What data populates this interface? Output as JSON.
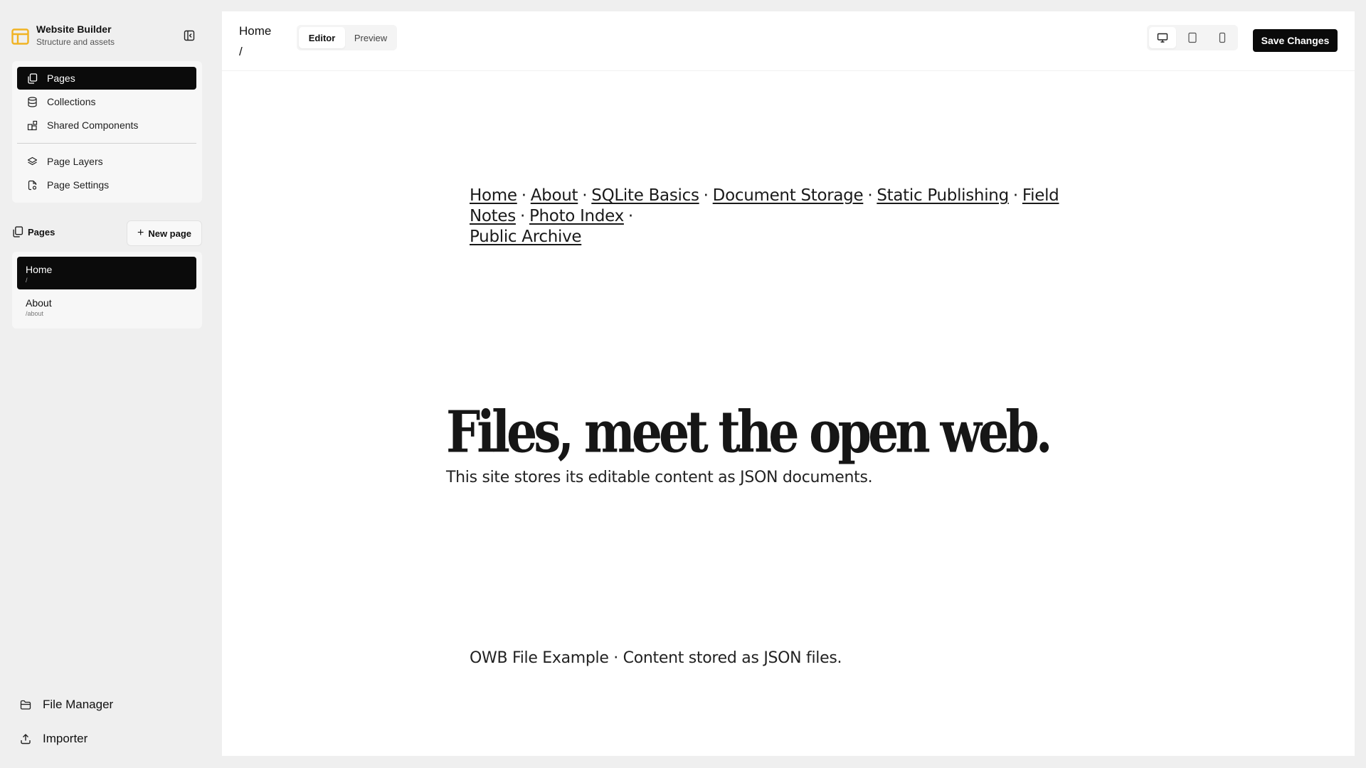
{
  "app": {
    "title": "Website Builder",
    "subtitle": "Structure and assets",
    "accent_color": "#f0b323",
    "logo_icon": "layout-icon",
    "collapse_icon": "sidebar-collapse-icon"
  },
  "sidebar": {
    "nav_items": [
      {
        "label": "Pages",
        "icon": "pages-icon",
        "active": true
      },
      {
        "label": "Collections",
        "icon": "database-icon",
        "active": false
      },
      {
        "label": "Shared Components",
        "icon": "components-icon",
        "active": false
      },
      {
        "label": "Page Layers",
        "icon": "layers-icon",
        "active": false
      },
      {
        "label": "Page Settings",
        "icon": "page-settings-icon",
        "active": false
      }
    ],
    "pages_section": {
      "label": "Pages",
      "new_page_label": "New page"
    },
    "pages": [
      {
        "name": "Home",
        "path": "/",
        "active": true
      },
      {
        "name": "About",
        "path": "/about",
        "active": false
      }
    ],
    "bottom_items": [
      {
        "label": "File Manager",
        "icon": "folder-icon"
      },
      {
        "label": "Importer",
        "icon": "upload-icon"
      }
    ]
  },
  "topbar": {
    "page_title": "Home",
    "page_path": "/",
    "tabs": [
      {
        "label": "Editor",
        "active": true
      },
      {
        "label": "Preview",
        "active": false
      }
    ],
    "devices": [
      {
        "name": "desktop",
        "icon": "desktop-icon",
        "active": true
      },
      {
        "name": "tablet",
        "icon": "tablet-icon",
        "active": false
      },
      {
        "name": "mobile",
        "icon": "mobile-icon",
        "active": false
      }
    ],
    "save_label": "Save Changes"
  },
  "canvas": {
    "nav_links": [
      "Home",
      "About",
      "SQLite Basics",
      "Document Storage",
      "Static Publishing",
      "Field Notes",
      "Photo Index",
      "Public Archive"
    ],
    "nav_separator": "·",
    "hero_title": "Files, meet the open web.",
    "hero_subtitle": "This site stores its editable content as JSON documents.",
    "footer_text": "OWB File Example · Content stored as JSON files."
  }
}
